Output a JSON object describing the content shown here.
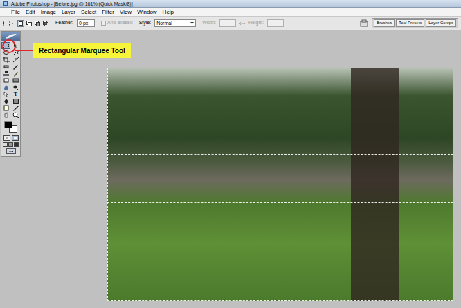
{
  "window": {
    "title": "Adobe Photoshop - [Before.jpg @ 161% (Quick Mask/8)]"
  },
  "menu": [
    "File",
    "Edit",
    "Image",
    "Layer",
    "Select",
    "Filter",
    "View",
    "Window",
    "Help"
  ],
  "options": {
    "feather_label": "Feather:",
    "feather_value": "0 px",
    "anti_aliased": {
      "label": "Anti-aliased",
      "checked": false,
      "disabled": true
    },
    "style_label": "Style:",
    "style_value": "Normal",
    "width_label": "Width:",
    "width_disabled": true,
    "height_label": "Height:",
    "height_disabled": true
  },
  "palette_tabs": [
    "Brushes",
    "Tool Presets",
    "Layer Comps"
  ],
  "tools": [
    {
      "kind": "icon",
      "selected": true
    },
    {
      "kind": "icon",
      "selected": false
    },
    {
      "kind": "icon",
      "selected": false
    },
    {
      "kind": "icon",
      "selected": false
    },
    {
      "kind": "icon",
      "selected": false
    },
    {
      "kind": "icon",
      "selected": false
    },
    {
      "kind": "icon",
      "selected": false
    },
    {
      "kind": "icon",
      "selected": false
    },
    {
      "kind": "icon",
      "selected": false
    },
    {
      "kind": "icon",
      "selected": false
    },
    {
      "kind": "icon",
      "selected": false
    },
    {
      "kind": "icon",
      "selected": false
    },
    {
      "kind": "icon",
      "selected": false
    },
    {
      "kind": "icon",
      "selected": false
    },
    {
      "kind": "icon",
      "selected": false
    },
    {
      "kind": "glyph",
      "glyph": "T",
      "selected": false
    },
    {
      "kind": "icon",
      "selected": false
    },
    {
      "kind": "icon",
      "selected": false
    },
    {
      "kind": "icon",
      "selected": false
    },
    {
      "kind": "icon",
      "selected": false
    },
    {
      "kind": "icon",
      "selected": false
    },
    {
      "kind": "icon",
      "selected": false
    }
  ],
  "swatches": {
    "foreground": "#000000",
    "background": "#ffffff"
  },
  "canvas": {
    "selection_visible": true
  },
  "annotation": {
    "label": "Rectangular Marquee Tool"
  }
}
